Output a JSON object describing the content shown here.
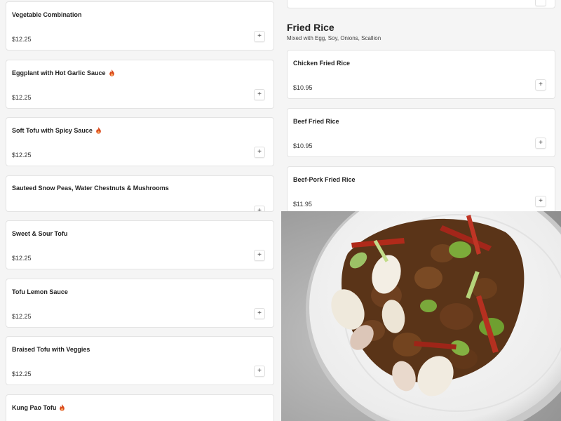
{
  "left_items": [
    {
      "name": "Vegetable Combination",
      "price": "$12.25",
      "spicy": false
    },
    {
      "name": "Eggplant with Hot Garlic Sauce",
      "price": "$12.25",
      "spicy": true
    },
    {
      "name": "Soft Tofu with Spicy Sauce",
      "price": "$12.25",
      "spicy": true
    },
    {
      "name": "Sauteed Snow Peas, Water Chestnuts & Mushrooms",
      "price": "",
      "spicy": false
    },
    {
      "name": "Sweet & Sour Tofu",
      "price": "$12.25",
      "spicy": false
    },
    {
      "name": "Tofu Lemon Sauce",
      "price": "$12.25",
      "spicy": false
    },
    {
      "name": "Braised Tofu with Veggies",
      "price": "$12.25",
      "spicy": false
    },
    {
      "name": "Kung Pao Tofu",
      "price": "",
      "spicy": true
    }
  ],
  "section": {
    "title": "Fried Rice",
    "subtitle": "Mixed with Egg, Soy, Onions, Scallion"
  },
  "right_items": [
    {
      "name": "Chicken Fried Rice",
      "price": "$10.95"
    },
    {
      "name": "Beef Fried Rice",
      "price": "$10.95"
    },
    {
      "name": "Beef-Pork Fried Rice",
      "price": "$11.95"
    }
  ],
  "add_symbol": "+",
  "colors": {
    "spicy": "#d9481a",
    "card_border": "#e3e3e3",
    "background": "#f5f5f5"
  },
  "icons": {
    "spicy": "flame-icon",
    "add": "plus-icon"
  }
}
